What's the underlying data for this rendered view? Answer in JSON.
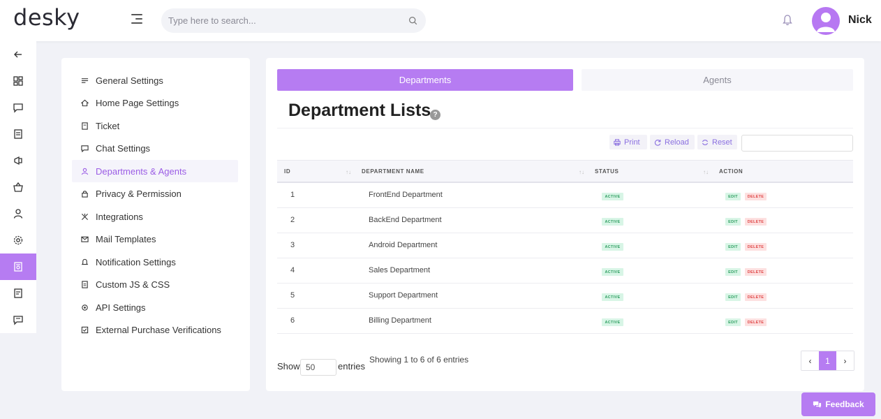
{
  "app": {
    "logo": "desky"
  },
  "header": {
    "search_placeholder": "Type here to search...",
    "user_name": "Nick"
  },
  "rail": {
    "icons": [
      "back-arrow-icon",
      "dashboard-icon",
      "chat-icon",
      "ticket-icon",
      "megaphone-icon",
      "basket-icon",
      "user-icon",
      "gear-icon",
      "settings-page-icon",
      "document-icon",
      "message-icon"
    ],
    "active_index": 8
  },
  "settings_menu": {
    "items": [
      {
        "label": "General Settings",
        "icon": "sliders-icon"
      },
      {
        "label": "Home Page Settings",
        "icon": "home-icon"
      },
      {
        "label": "Ticket",
        "icon": "ticket-icon"
      },
      {
        "label": "Chat Settings",
        "icon": "chat-icon"
      },
      {
        "label": "Departments & Agents",
        "icon": "user-icon"
      },
      {
        "label": "Privacy & Permission",
        "icon": "lock-icon"
      },
      {
        "label": "Integrations",
        "icon": "integration-icon"
      },
      {
        "label": "Mail Templates",
        "icon": "mail-icon"
      },
      {
        "label": "Notification Settings",
        "icon": "bell-icon"
      },
      {
        "label": "Custom JS & CSS",
        "icon": "code-file-icon"
      },
      {
        "label": "API Settings",
        "icon": "api-icon"
      },
      {
        "label": "External Purchase Verifications",
        "icon": "check-square-icon"
      }
    ],
    "active_index": 4
  },
  "tabs": {
    "departments": "Departments",
    "agents": "Agents",
    "active": "departments"
  },
  "page": {
    "title": "Department Lists",
    "help": "?"
  },
  "toolbar": {
    "print": "Print",
    "reload": "Reload",
    "reset": "Reset"
  },
  "table": {
    "columns": {
      "id": "ID",
      "name": "DEPARTMENT NAME",
      "status": "STATUS",
      "action": "ACTION"
    },
    "rows": [
      {
        "id": "1",
        "name": "FrontEnd Department",
        "status": "ACTIVE"
      },
      {
        "id": "2",
        "name": "BackEnd Department",
        "status": "ACTIVE"
      },
      {
        "id": "3",
        "name": "Android Department",
        "status": "ACTIVE"
      },
      {
        "id": "4",
        "name": "Sales Department",
        "status": "ACTIVE"
      },
      {
        "id": "5",
        "name": "Support Department",
        "status": "ACTIVE"
      },
      {
        "id": "6",
        "name": "Billing Department",
        "status": "ACTIVE"
      }
    ],
    "actions": {
      "edit": "EDIT",
      "delete": "DELETE"
    }
  },
  "footer": {
    "show": "Show",
    "page_size": "50",
    "entries": "entries",
    "showing": "Showing 1 to 6 of 6 entries",
    "current_page": "1",
    "prev": "‹",
    "next": "›"
  },
  "feedback": {
    "label": "Feedback"
  },
  "colors": {
    "accent": "#b67cf2",
    "active_green": "#2e9e60",
    "delete_red": "#e04848"
  }
}
